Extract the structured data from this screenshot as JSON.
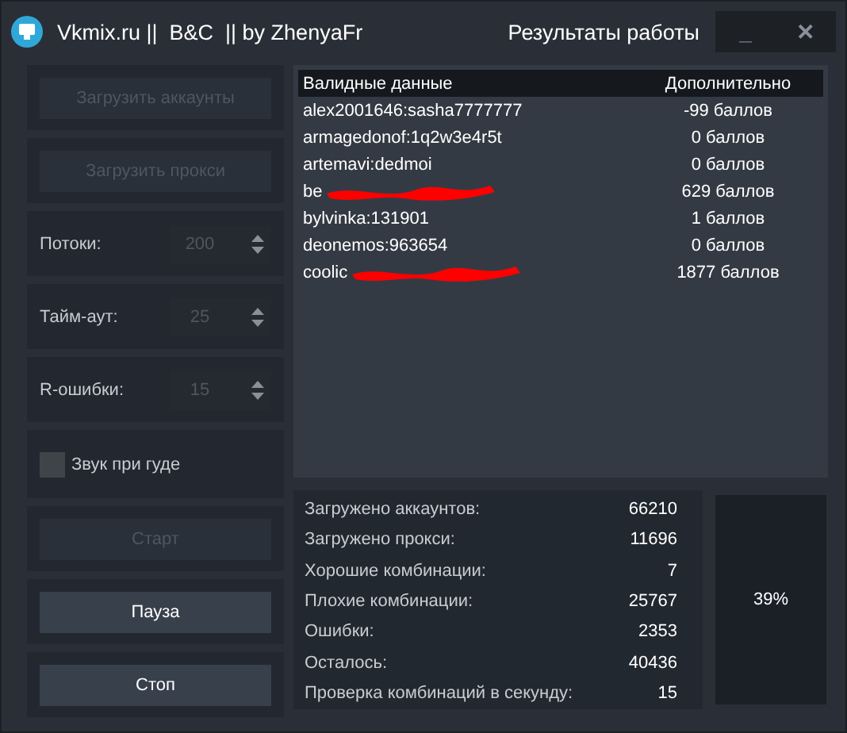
{
  "window": {
    "title": "Vkmix.ru ||  B&C  || by ZhenyaFr",
    "section_title": "Результаты работы",
    "controls": [
      "_",
      "✕"
    ]
  },
  "left_panel": [
    {
      "kind": "button",
      "label": "Загрузить аккаунты",
      "disabled": true
    },
    {
      "kind": "button",
      "label": "Загрузить прокси",
      "disabled": true
    },
    {
      "kind": "spinner",
      "label": "Потоки:",
      "value": "200",
      "disabled": true
    },
    {
      "kind": "spinner",
      "label": "Тайм-аут:",
      "value": "25",
      "disabled": true
    },
    {
      "kind": "spinner",
      "label": "R-ошибки:",
      "value": "15",
      "disabled": true
    },
    {
      "kind": "checkbox",
      "label": "Звук при гуде",
      "checked": false
    },
    {
      "kind": "button",
      "label": "Старт",
      "disabled": true
    },
    {
      "kind": "button",
      "label": "Пауза",
      "disabled": false
    },
    {
      "kind": "button",
      "label": "Стоп",
      "disabled": false
    }
  ],
  "results_table": {
    "columns": [
      "Валидные данные",
      "Дополнительно"
    ],
    "rows": [
      {
        "data": "alex2001646:sasha7777777",
        "extra": "-99 баллов",
        "redacted": false
      },
      {
        "data": "armagedonof:1q2w3e4r5t",
        "extra": "0 баллов",
        "redacted": false
      },
      {
        "data": "artemavi:dedmoi",
        "extra": "0 баллов",
        "redacted": false
      },
      {
        "data": "be",
        "extra": "629 баллов",
        "redacted": true
      },
      {
        "data": "bylvinka:131901",
        "extra": "1 баллов",
        "redacted": false
      },
      {
        "data": "deonemos:963654",
        "extra": "0 баллов",
        "redacted": false
      },
      {
        "data": "coolic",
        "extra": "1877 баллов",
        "redacted": true
      }
    ]
  },
  "stats": [
    {
      "label": "Загружено аккаунтов:",
      "value": "66210"
    },
    {
      "label": "Загружено прокси:",
      "value": "11696"
    },
    {
      "label": "Хорошие комбинации:",
      "value": "7"
    },
    {
      "label": "Плохие комбинации:",
      "value": "25767"
    },
    {
      "label": "Ошибки:",
      "value": "2353"
    },
    {
      "label": "Осталось:",
      "value": "40436"
    },
    {
      "label": "Проверка комбинаций в секунду:",
      "value": "15"
    }
  ],
  "progress": {
    "text": "39%"
  }
}
